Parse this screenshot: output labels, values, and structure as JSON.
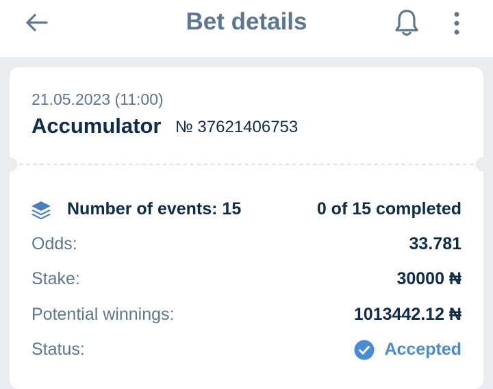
{
  "header": {
    "title": "Bet details",
    "back_icon": "arrow-left-icon",
    "bell_icon": "bell-icon",
    "more_icon": "more-vertical-icon"
  },
  "bet": {
    "date": "21.05.2023 (11:00)",
    "type": "Accumulator",
    "number": "№ 37621406753"
  },
  "details": {
    "events_label": "Number of events: 15",
    "events_progress": "0 of 15 completed",
    "odds_label": "Odds:",
    "odds_value": "33.781",
    "stake_label": "Stake:",
    "stake_value": "30000 ₦",
    "winnings_label": "Potential winnings:",
    "winnings_value": "1013442.12 ₦",
    "status_label": "Status:",
    "status_value": "Accepted"
  },
  "colors": {
    "accent": "#5c7791",
    "dark_text": "#0f2c4c",
    "status_accepted": "#4a8bd6",
    "events_icon": "#4a7fbd"
  }
}
